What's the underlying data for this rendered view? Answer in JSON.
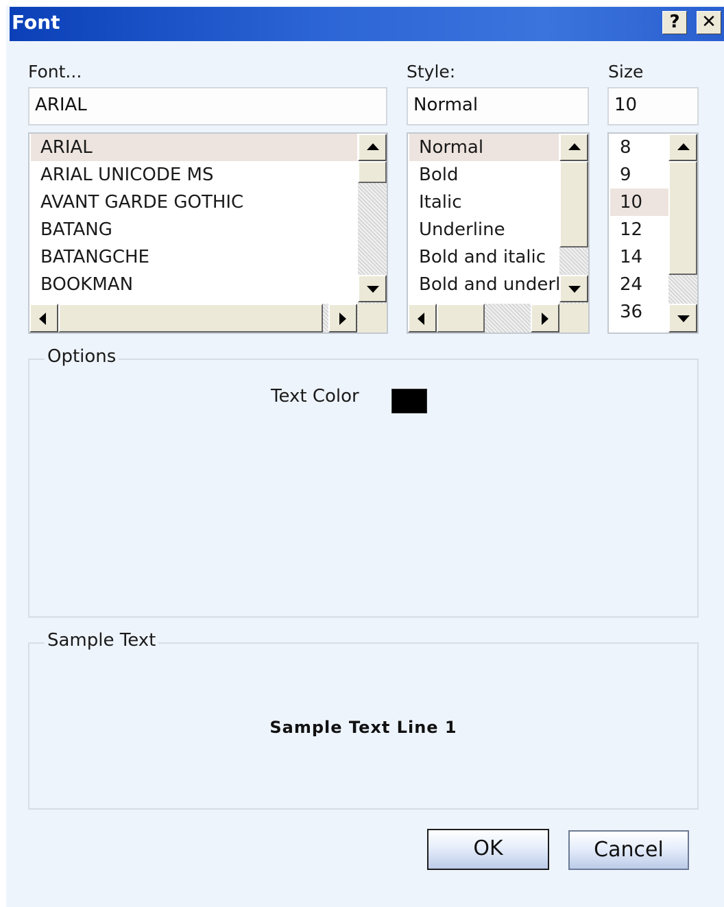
{
  "window": {
    "title": "Font",
    "help_label": "?",
    "close_label": "✕"
  },
  "font": {
    "label": "Font...",
    "value": "ARIAL",
    "items": [
      {
        "label": "ARIAL",
        "selected": true
      },
      {
        "label": "ARIAL UNICODE MS",
        "selected": false
      },
      {
        "label": "AVANT GARDE GOTHIC",
        "selected": false
      },
      {
        "label": "BATANG",
        "selected": false
      },
      {
        "label": "BATANGCHE",
        "selected": false
      },
      {
        "label": "BOOKMAN",
        "selected": false
      }
    ]
  },
  "style": {
    "label": "Style:",
    "value": "Normal",
    "items": [
      {
        "label": "Normal",
        "selected": true
      },
      {
        "label": "Bold",
        "selected": false
      },
      {
        "label": "Italic",
        "selected": false
      },
      {
        "label": "Underline",
        "selected": false
      },
      {
        "label": "Bold and italic",
        "selected": false
      },
      {
        "label": "Bold and underline",
        "selected": false
      }
    ]
  },
  "size": {
    "label": "Size",
    "value": "10",
    "items": [
      {
        "label": "8",
        "selected": false
      },
      {
        "label": "9",
        "selected": false
      },
      {
        "label": "10",
        "selected": true
      },
      {
        "label": "12",
        "selected": false
      },
      {
        "label": "14",
        "selected": false
      },
      {
        "label": "24",
        "selected": false
      },
      {
        "label": "36",
        "selected": false
      }
    ]
  },
  "options": {
    "legend": "Options",
    "text_color_label": "Text Color",
    "text_color": "#000000"
  },
  "sample": {
    "legend": "Sample Text",
    "line": "Sample Text Line 1"
  },
  "buttons": {
    "ok": "OK",
    "cancel": "Cancel"
  },
  "colors": {
    "title_bar": "#2d66d6",
    "dialog_bg": "#eef4fc",
    "selection": "#ede4df"
  }
}
